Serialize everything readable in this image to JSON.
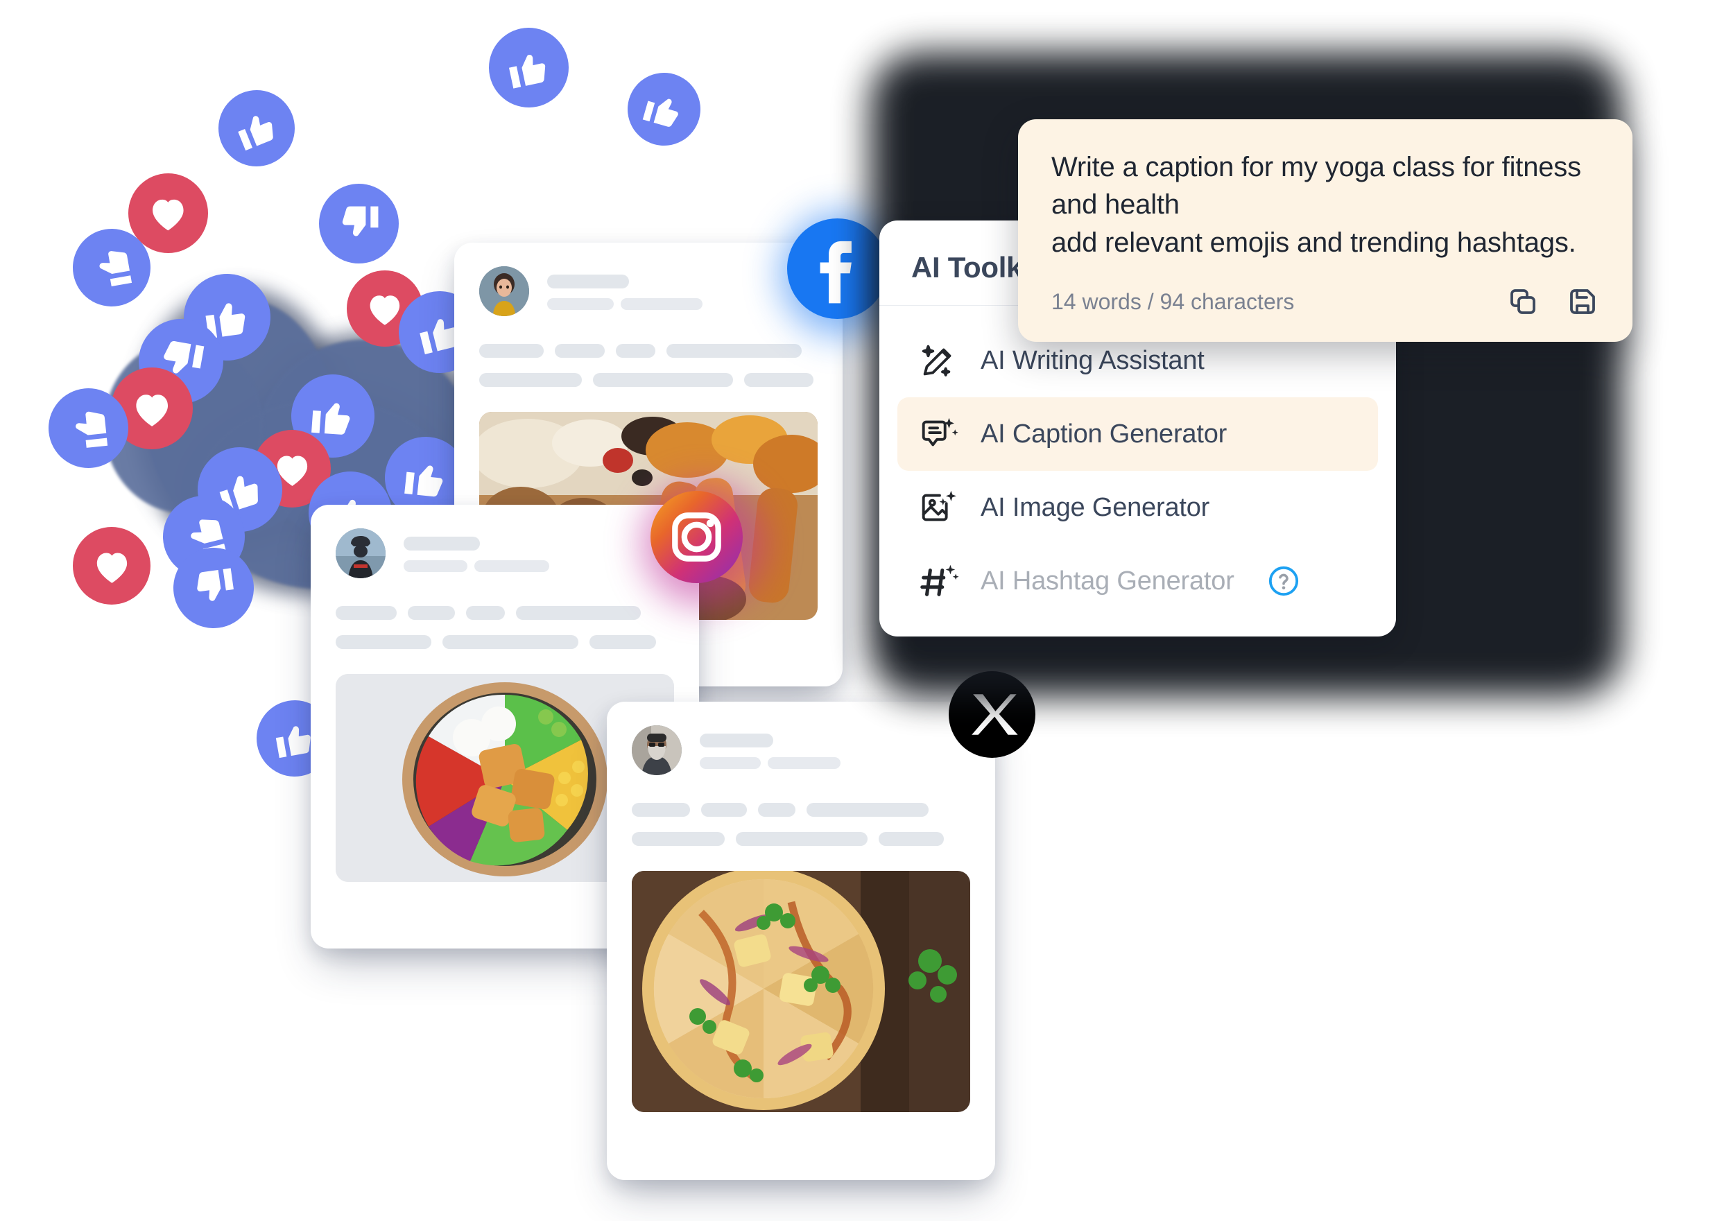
{
  "panel": {
    "title": "AI Toolkit",
    "items": [
      {
        "label": "AI Writing Assistant",
        "icon": "magic-pencil-icon",
        "state": "default"
      },
      {
        "label": "AI Caption Generator",
        "icon": "magic-caption-icon",
        "state": "active"
      },
      {
        "label": "AI Image Generator",
        "icon": "magic-image-icon",
        "state": "default"
      },
      {
        "label": "AI Hashtag Generator",
        "icon": "magic-hashtag-icon",
        "state": "disabled",
        "help": "help-icon"
      }
    ]
  },
  "prompt": {
    "text": "Write a caption for my yoga class for fitness\nand health\nadd relevant emojis and trending hashtags.",
    "counter": "14 words / 94 characters",
    "copy_icon": "copy-icon",
    "save_icon": "save-icon"
  },
  "social_badges": [
    {
      "name": "facebook",
      "label": "Facebook"
    },
    {
      "name": "instagram",
      "label": "Instagram"
    },
    {
      "name": "x",
      "label": "X"
    }
  ],
  "posts": [
    {
      "network": "facebook",
      "avatar": "woman-avatar",
      "media": "grilled-meat-platter-photo"
    },
    {
      "network": "instagram",
      "avatar": "cyclist-avatar",
      "media": "salad-bowl-photo"
    },
    {
      "network": "x",
      "avatar": "bearded-man-avatar",
      "media": "bbq-chicken-pizza-photo"
    }
  ],
  "reactions": {
    "like_label": "Like",
    "dislike_label": "Dislike",
    "love_label": "Love"
  },
  "colors": {
    "reaction_blue": "#6D83F2",
    "reaction_red": "#DD4B62",
    "facebook_blue": "#1877F2",
    "highlight_cream": "#FDF3E6",
    "prompt_bg": "#FDF3E4",
    "text_dark": "#3B475C",
    "help_blue": "#1DA1F2"
  }
}
